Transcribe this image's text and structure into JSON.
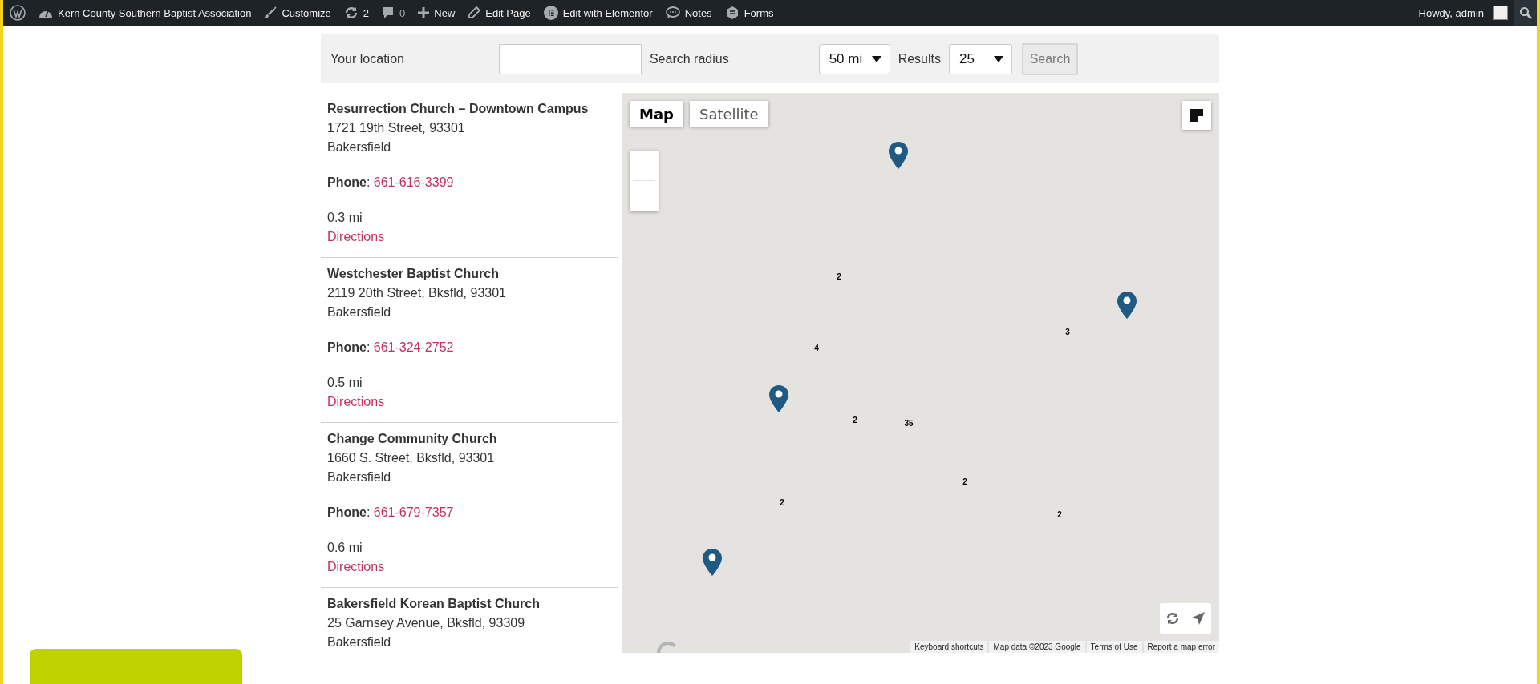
{
  "admin_bar": {
    "site_name": "Kern County Southern Baptist Association",
    "items": [
      {
        "kind": "customize",
        "label": "Customize"
      },
      {
        "kind": "updates",
        "label": "2"
      },
      {
        "kind": "comments",
        "label": "0"
      },
      {
        "kind": "new",
        "label": "New"
      },
      {
        "kind": "edit",
        "label": "Edit Page"
      },
      {
        "kind": "elementor",
        "label": "Edit with Elementor"
      },
      {
        "kind": "notes",
        "label": "Notes"
      },
      {
        "kind": "forms",
        "label": "Forms"
      }
    ],
    "greeting": "Howdy, admin"
  },
  "search": {
    "location_label": "Your location",
    "radius_label": "Search radius",
    "radius_value": "50 mi",
    "results_label": "Results",
    "results_value": "25",
    "button": "Search"
  },
  "results": [
    {
      "name": "Resurrection Church – Downtown Campus",
      "address": "1721 19th Street, 93301",
      "city": "Bakersfield",
      "phone_label": "**Phone**:",
      "phone": "661-616-3399",
      "distance": "0.3 mi",
      "directions": "Directions"
    },
    {
      "name": "Westchester Baptist Church",
      "address": "2119 20th Street, Bksfld, 93301",
      "city": "Bakersfield",
      "phone_label": "**Phone**:",
      "phone": "661-324-2752",
      "distance": "0.5 mi",
      "directions": "Directions"
    },
    {
      "name": "Change Community Church",
      "address": "1660 S. Street, Bksfld, 93301",
      "city": "Bakersfield",
      "phone_label": "**Phone**:",
      "phone": "661-679-7357",
      "distance": "0.6 mi",
      "directions": "Directions"
    },
    {
      "name": "Bakersfield Korean Baptist Church",
      "address": "25 Garnsey Avenue, Bksfld, 93309",
      "city": "Bakersfield"
    }
  ],
  "map": {
    "map_types": [
      {
        "label": "Map",
        "selected": true
      },
      {
        "label": "Satellite",
        "selected": false
      }
    ],
    "clusters": [
      "2",
      "4",
      "3",
      "2",
      "35",
      "2",
      "2",
      "2"
    ],
    "attribution": [
      "Keyboard shortcuts",
      "Map data ©2023 Google",
      "Terms of Use",
      "Report a map error"
    ]
  }
}
